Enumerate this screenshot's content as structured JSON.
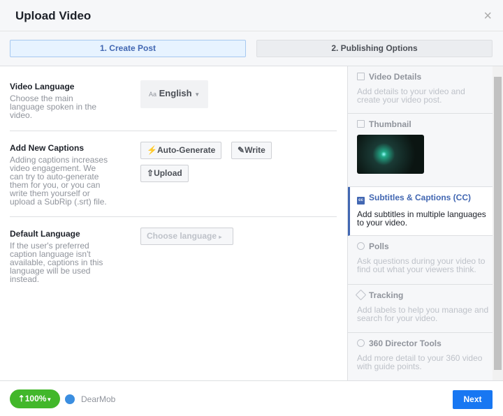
{
  "header": {
    "title": "Upload Video",
    "close": "×"
  },
  "tabs": [
    {
      "label": "1. Create Post",
      "active": true
    },
    {
      "label": "2. Publishing Options",
      "active": false
    }
  ],
  "sections": {
    "video_language": {
      "title": "Video Language",
      "desc": "Choose the main language spoken in the video.",
      "select_prefix": "Aa",
      "select_value": "English"
    },
    "captions": {
      "title": "Add New Captions",
      "desc": "Adding captions increases video engagement. We can try to auto-generate them for you, or you can write them yourself or upload a SubRip (.srt) file.",
      "auto": "Auto-Generate",
      "write": "Write",
      "upload": "Upload"
    },
    "default_language": {
      "title": "Default Language",
      "desc": "If the user's preferred caption language isn't available, captions in this language will be used instead.",
      "select": "Choose language"
    }
  },
  "sidebar": [
    {
      "title": "Video Details",
      "desc": "Add details to your video and create your video post."
    },
    {
      "title": "Thumbnail"
    },
    {
      "title": "Subtitles & Captions (CC)",
      "desc": "Add subtitles in multiple languages to your video.",
      "icon_text": "cc"
    },
    {
      "title": "Polls",
      "desc": "Ask questions during your video to find out what your viewers think."
    },
    {
      "title": "Tracking",
      "desc": "Add labels to help you manage and search for your video."
    },
    {
      "title": "360 Director Tools",
      "desc": "Add more detail to your 360 video with guide points."
    }
  ],
  "footer": {
    "progress": "100%",
    "page_name": "DearMob",
    "next": "Next"
  },
  "colors": {
    "accent": "#4267b2",
    "progress": "#42b72a",
    "next": "#1877f2"
  }
}
